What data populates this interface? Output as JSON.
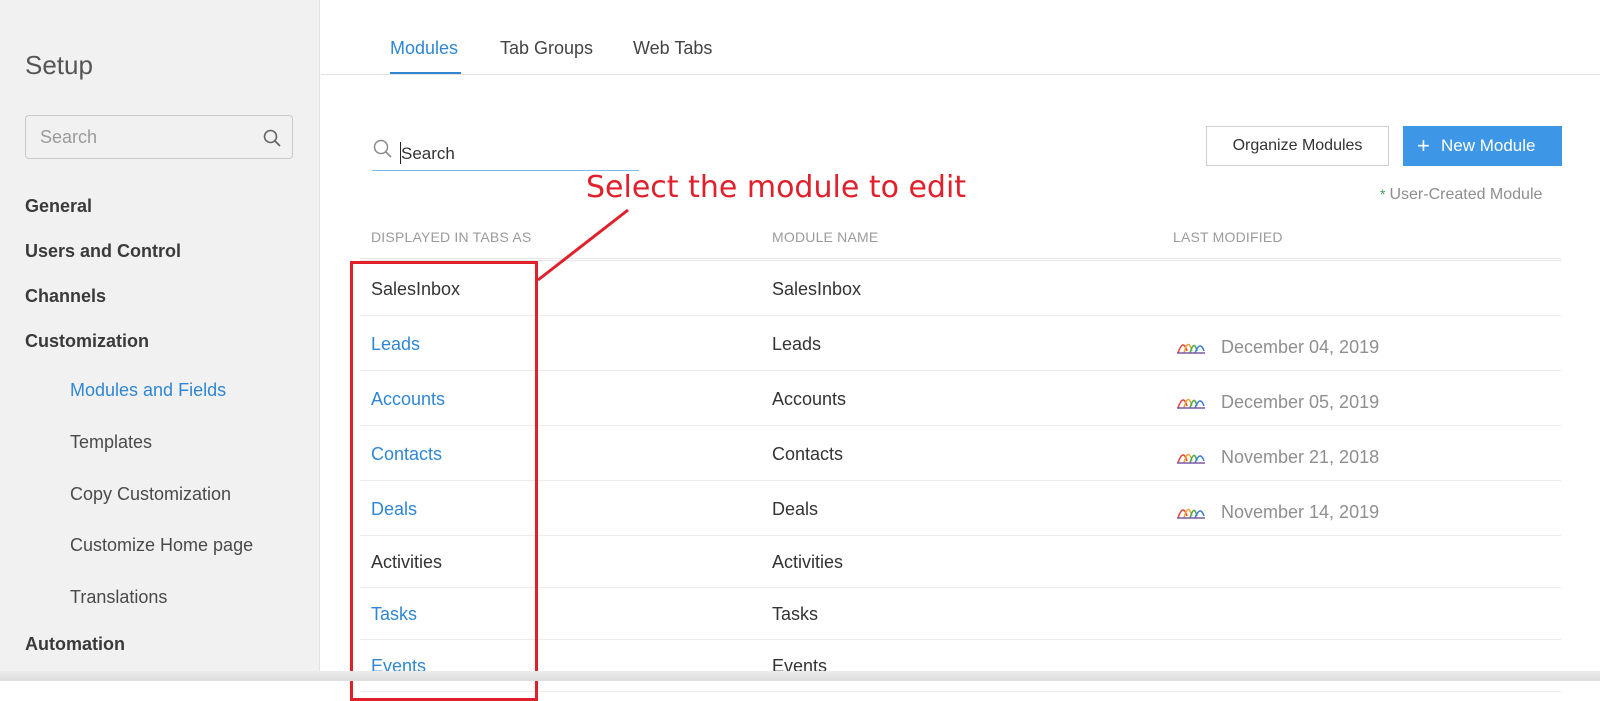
{
  "sidebar": {
    "title": "Setup",
    "search_placeholder": "Search",
    "sections": {
      "general": "General",
      "users_and_control": "Users and Control",
      "channels": "Channels",
      "customization": "Customization",
      "automation": "Automation"
    },
    "customization_items": [
      {
        "label": "Modules and Fields",
        "active": true
      },
      {
        "label": "Templates",
        "active": false
      },
      {
        "label": "Copy Customization",
        "active": false
      },
      {
        "label": "Customize Home page",
        "active": false
      },
      {
        "label": "Translations",
        "active": false
      }
    ]
  },
  "tabs": [
    {
      "label": "Modules",
      "active": true
    },
    {
      "label": "Tab Groups",
      "active": false
    },
    {
      "label": "Web Tabs",
      "active": false
    }
  ],
  "toolbar": {
    "search_value": "Search",
    "organize_label": "Organize Modules",
    "new_module_plus": "+",
    "new_module_label": "New Module",
    "legend_star": "*",
    "legend_label": "User-Created Module"
  },
  "table": {
    "headers": {
      "displayed_in_tabs_as": "DISPLAYED IN TABS AS",
      "module_name": "MODULE NAME",
      "last_modified": "LAST MODIFIED"
    },
    "rows": [
      {
        "tab": "SalesInbox",
        "module": "SalesInbox",
        "date": "",
        "link": false
      },
      {
        "tab": "Leads",
        "module": "Leads",
        "date": "December 04, 2019",
        "link": true
      },
      {
        "tab": "Accounts",
        "module": "Accounts",
        "date": "December 05, 2019",
        "link": true
      },
      {
        "tab": "Contacts",
        "module": "Contacts",
        "date": "November 21, 2018",
        "link": true
      },
      {
        "tab": "Deals",
        "module": "Deals",
        "date": "November 14, 2019",
        "link": true
      },
      {
        "tab": "Activities",
        "module": "Activities",
        "date": "",
        "link": false
      },
      {
        "tab": "Tasks",
        "module": "Tasks",
        "date": "",
        "link": true
      },
      {
        "tab": "Events",
        "module": "Events",
        "date": "",
        "link": true
      }
    ]
  },
  "annotation": {
    "text": "Select the module to edit",
    "color": "#e0202b"
  },
  "colors": {
    "accent": "#2f87d4",
    "button_primary": "#3d97e6",
    "sidebar_bg": "#f1f1f1"
  }
}
